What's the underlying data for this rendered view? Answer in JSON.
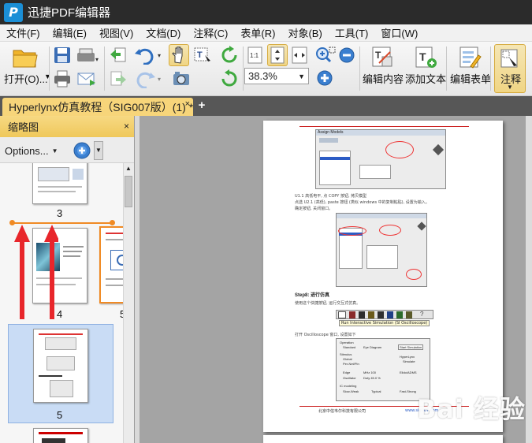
{
  "app": {
    "title": "迅捷PDF编辑器",
    "logo_letter": "P"
  },
  "menu": [
    "文件(F)",
    "编辑(E)",
    "视图(V)",
    "文档(D)",
    "注释(C)",
    "表单(R)",
    "对象(B)",
    "工具(T)",
    "窗口(W)"
  ],
  "toolbar": {
    "open_label": "打开(O)...",
    "zoom_value": "38.3%",
    "edit_content_label": "编辑内容",
    "add_text_label": "添加文本",
    "edit_form_label": "编辑表单",
    "comment_label": "注释"
  },
  "tab": {
    "title": "Hyperlynx仿真教程（SIG007版）(1) *",
    "close": "×",
    "new": "+"
  },
  "panel": {
    "title": "缩略图",
    "close": "×",
    "options_label": "Options...",
    "thumbnails": [
      {
        "label": "3"
      },
      {
        "label": "4"
      },
      {
        "label": "5"
      },
      {
        "label": "5"
      }
    ]
  },
  "page": {
    "step_heading": "Step8: 进行仿真",
    "bullets": [
      "U1.1 高低电平, 点 COPY 按钮, 拷贝模型",
      "点选 U2.1 (高低), paste 按钮 (类似 windows 中的复制粘贴), 设置为输入。",
      "确定按钮, 关闭窗口。",
      "使用这个快捷按钮, 运行交互式仿真。",
      "打开 Oscilloscope 窗口, 设置如下"
    ],
    "tooltip": "Run Interactive Simulation (SI Oscilloscope)",
    "footer_company": "北京中信韦尔科技有限公司",
    "footer_url": "www.sig007.com",
    "dialog_title": "Assign Models",
    "osc_labels": [
      "Operation",
      "Standard",
      "Eye Diagram",
      "Start Simulation",
      "Stimulus",
      "Global",
      "Per-Net/Pin",
      "Edge",
      "Oscillator",
      "MHz 100",
      "Duty 45.0 %",
      "IC modeling",
      "Slow-Weak",
      "Typical",
      "Fast-Strong",
      "HyperLynx",
      "Simulate",
      "Elldo/ADMS"
    ]
  },
  "watermark": "Bai 经验",
  "colors": {
    "accent": "#f7d57a",
    "arrow": "#e8262b",
    "selected_thumb": "#c9dcf5",
    "drag_line": "#f08a24"
  }
}
